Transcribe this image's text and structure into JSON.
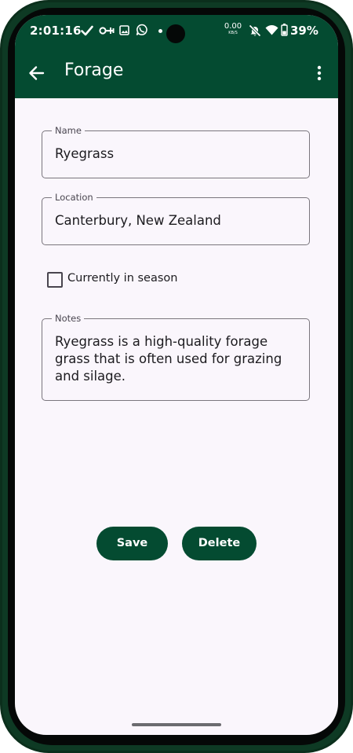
{
  "status_bar": {
    "time": "2:01:16",
    "net_speed_value": "0.00",
    "net_speed_unit": "KB/S",
    "battery_percent": "39%"
  },
  "app_bar": {
    "title": "Forage"
  },
  "form": {
    "name": {
      "label": "Name",
      "value": "Ryegrass"
    },
    "location": {
      "label": "Location",
      "value": "Canterbury, New Zealand"
    },
    "in_season": {
      "label": "Currently in season",
      "checked": false
    },
    "notes": {
      "label": "Notes",
      "value": "Ryegrass is a high-quality forage grass that is often used for grazing and silage."
    }
  },
  "actions": {
    "save_label": "Save",
    "delete_label": "Delete"
  },
  "colors": {
    "primary": "#044b31",
    "background": "#faf6fc",
    "outline": "#7a767d"
  },
  "icons": [
    "back-arrow-icon",
    "more-vert-icon",
    "check-icon",
    "key-icon",
    "image-icon",
    "chat-icon",
    "mute-icon",
    "wifi-icon",
    "battery-icon"
  ]
}
